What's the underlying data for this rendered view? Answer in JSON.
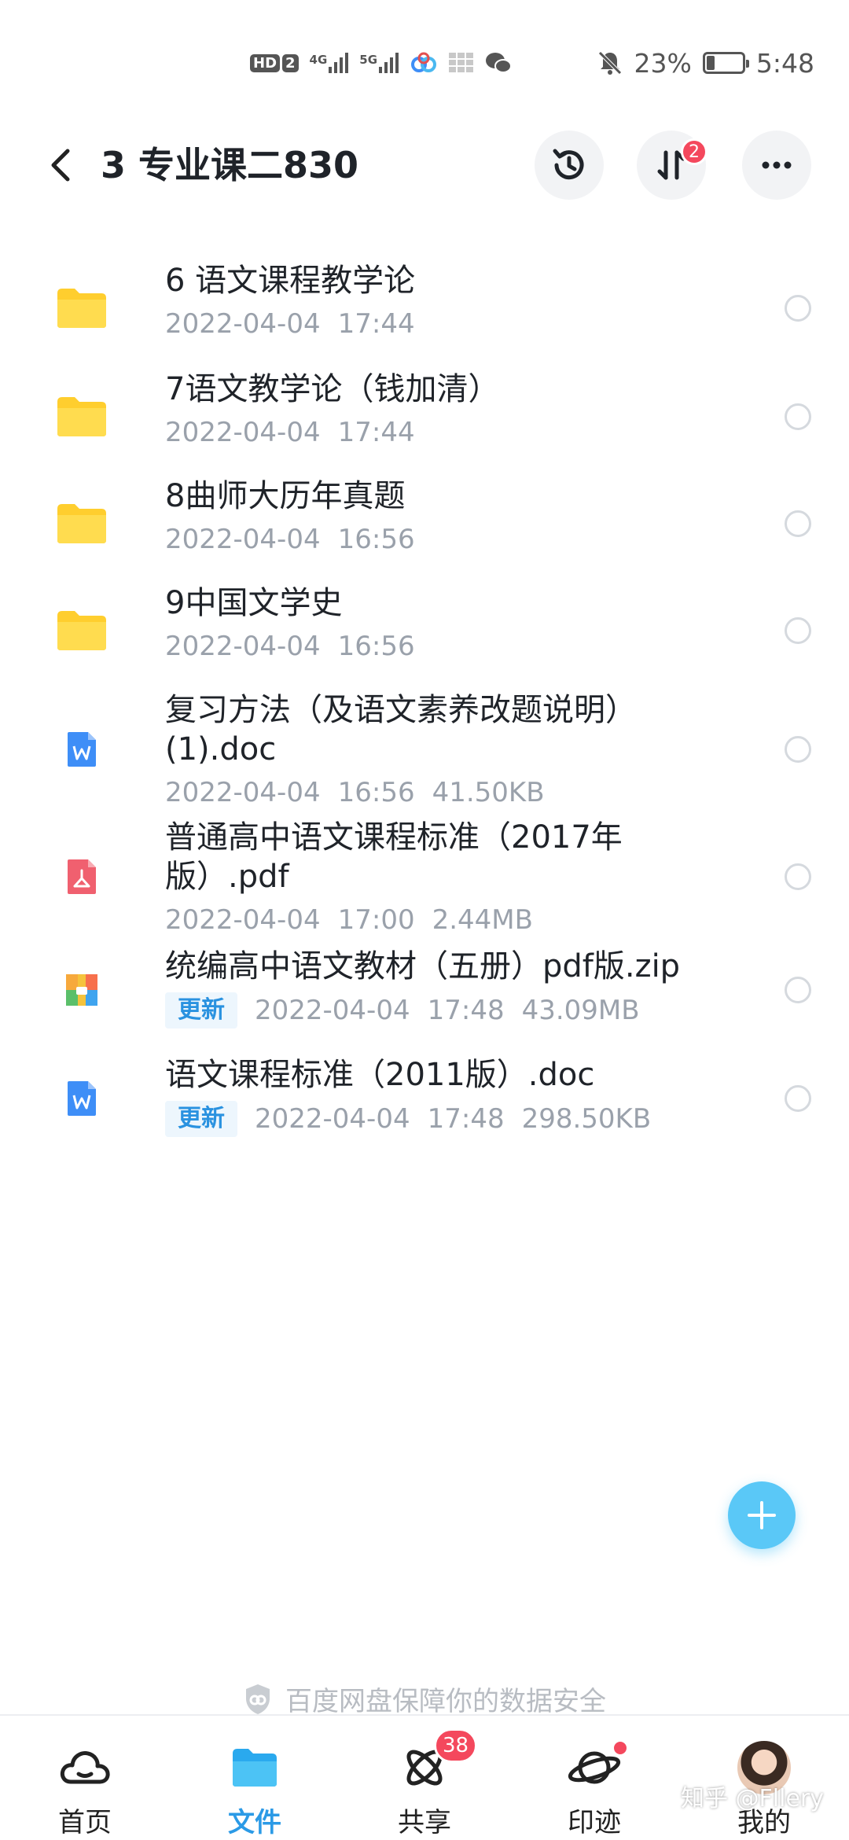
{
  "status_bar": {
    "hd": "HD",
    "sim": "2",
    "net1": "4G",
    "net2": "5G",
    "battery": "23%",
    "battery_level": 0.23,
    "time": "5:48"
  },
  "header": {
    "title": "3 专业课二830",
    "transfer_badge": "2"
  },
  "files": [
    {
      "name": "6 语文课程教学论",
      "date": "2022-04-04",
      "time": "17:44",
      "size": "",
      "tag": "",
      "icon": "folder-icon"
    },
    {
      "name": "7语文教学论（钱加清）",
      "date": "2022-04-04",
      "time": "17:44",
      "size": "",
      "tag": "",
      "icon": "folder-icon"
    },
    {
      "name": "8曲师大历年真题",
      "date": "2022-04-04",
      "time": "16:56",
      "size": "",
      "tag": "",
      "icon": "folder-icon"
    },
    {
      "name": "9中国文学史",
      "date": "2022-04-04",
      "time": "16:56",
      "size": "",
      "tag": "",
      "icon": "folder-icon"
    },
    {
      "name": "复习方法（及语文素养改题说明）(1).doc",
      "date": "2022-04-04",
      "time": "16:56",
      "size": "41.50KB",
      "tag": "",
      "icon": "word-doc-icon"
    },
    {
      "name": "普通高中语文课程标准（2017年版）.pdf",
      "date": "2022-04-04",
      "time": "17:00",
      "size": "2.44MB",
      "tag": "",
      "icon": "pdf-icon"
    },
    {
      "name": "统编高中语文教材（五册）pdf版.zip",
      "date": "2022-04-04",
      "time": "17:48",
      "size": "43.09MB",
      "tag": "更新",
      "icon": "zip-icon"
    },
    {
      "name": "语文课程标准（2011版）.doc",
      "date": "2022-04-04",
      "time": "17:48",
      "size": "298.50KB",
      "tag": "更新",
      "icon": "word-doc-icon"
    }
  ],
  "security_note": "百度网盘保障你的数据安全",
  "tabs": [
    {
      "label": "首页",
      "icon": "cloud-icon",
      "active": false,
      "badge": ""
    },
    {
      "label": "文件",
      "icon": "folder-icon",
      "active": true,
      "badge": ""
    },
    {
      "label": "共享",
      "icon": "share-atom-icon",
      "active": false,
      "badge": "38"
    },
    {
      "label": "印迹",
      "icon": "planet-icon",
      "active": false,
      "badge": ""
    },
    {
      "label": "我的",
      "icon": "avatar",
      "active": false,
      "badge": ""
    }
  ],
  "watermark": "知乎 @Fllery",
  "colors": {
    "accent": "#2b9ae6",
    "folder": "#ffd84d",
    "word": "#3e8ef7",
    "pdf": "#f0606f",
    "badge": "#f4485d",
    "fab": "#5ac8f7"
  }
}
